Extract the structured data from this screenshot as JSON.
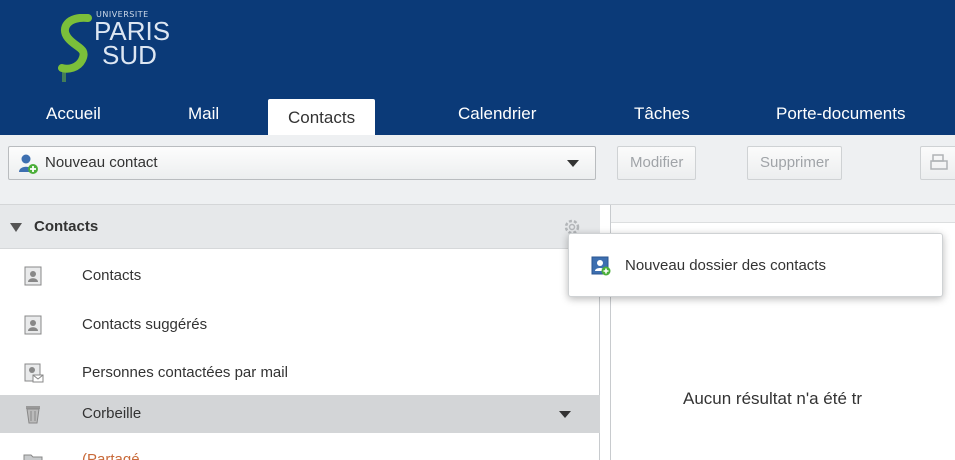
{
  "logo": {
    "line1": "UNIVERSITE",
    "line2": "PARIS",
    "line3": "SUD"
  },
  "tabs": [
    {
      "label": "Accueil",
      "active": false
    },
    {
      "label": "Mail",
      "active": false
    },
    {
      "label": "Contacts",
      "active": true
    },
    {
      "label": "Calendrier",
      "active": false
    },
    {
      "label": "Tâches",
      "active": false
    },
    {
      "label": "Porte-documents",
      "active": false
    }
  ],
  "toolbar": {
    "new_contact_label": "Nouveau contact",
    "edit_label": "Modifier",
    "delete_label": "Supprimer"
  },
  "sidebar": {
    "header_title": "Contacts",
    "items": [
      {
        "label": "Contacts",
        "icon": "address-book-icon"
      },
      {
        "label": "Contacts suggérés",
        "icon": "address-book-icon"
      },
      {
        "label": "Personnes contactées par mail",
        "icon": "address-book-mail-icon"
      },
      {
        "label": "Corbeille",
        "icon": "trash-icon",
        "selected": true
      },
      {
        "label": "(Partagé ...",
        "icon": "folder-icon"
      }
    ]
  },
  "main": {
    "no_result_text": "Aucun résultat n'a été tr"
  },
  "popup": {
    "label": "Nouveau dossier des contacts"
  },
  "colors": {
    "brand_blue": "#0b3a78",
    "selected_row": "#d3d5d7"
  }
}
